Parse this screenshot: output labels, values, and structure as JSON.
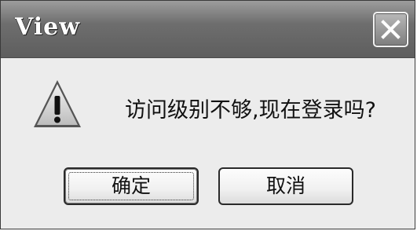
{
  "window": {
    "title": "View",
    "close_icon": "close-icon"
  },
  "body": {
    "icon": "warning-icon",
    "message": "访问级别不够,现在登录吗?"
  },
  "buttons": {
    "ok_label": "确定",
    "cancel_label": "取消"
  },
  "colors": {
    "titlebar": "#6e6e6e",
    "dialog_bg": "#ececec",
    "warning_fill": "#d4d4d4"
  }
}
